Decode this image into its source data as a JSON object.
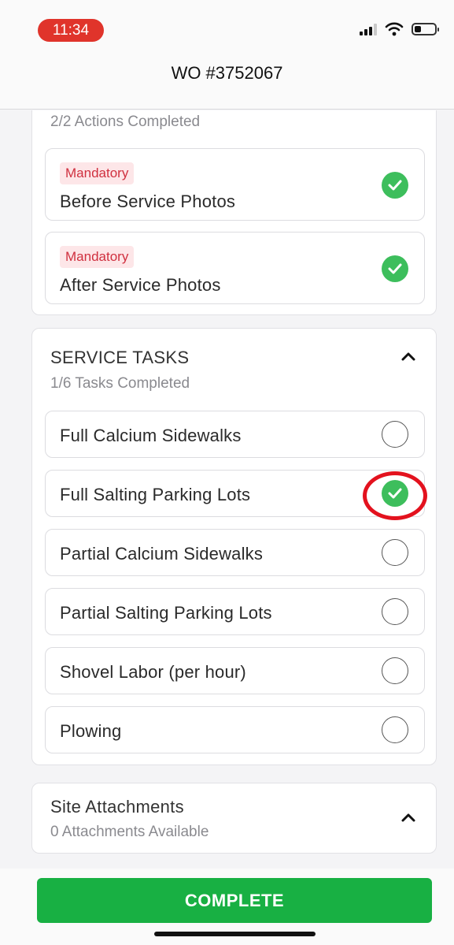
{
  "status_bar": {
    "time": "11:34",
    "icons": [
      "signal-icon",
      "wifi-icon",
      "battery-icon"
    ]
  },
  "header": {
    "title": "WO #3752067"
  },
  "actions_card": {
    "progress": "2/2 Actions Completed",
    "items": [
      {
        "badge": "Mandatory",
        "label": "Before Service Photos",
        "completed": true
      },
      {
        "badge": "Mandatory",
        "label": "After Service Photos",
        "completed": true
      }
    ]
  },
  "service_tasks": {
    "title": "SERVICE TASKS",
    "progress": "1/6 Tasks Completed",
    "items": [
      {
        "label": "Full Calcium Sidewalks",
        "completed": false
      },
      {
        "label": "Full Salting Parking Lots",
        "completed": true
      },
      {
        "label": "Partial Calcium Sidewalks",
        "completed": false
      },
      {
        "label": "Partial Salting Parking Lots",
        "completed": false
      },
      {
        "label": "Shovel Labor (per hour)",
        "completed": false
      },
      {
        "label": "Plowing",
        "completed": false
      }
    ]
  },
  "site_attachments": {
    "title": "Site Attachments",
    "subtitle": "0 Attachments Available"
  },
  "footer": {
    "complete_label": "COMPLETE"
  },
  "colors": {
    "accent_green": "#18b043",
    "check_green": "#3dbe5c",
    "mandatory_bg": "#fde6e8",
    "mandatory_text": "#d0303f",
    "time_pill": "#e0342b",
    "highlight_ring": "#e3121e"
  }
}
